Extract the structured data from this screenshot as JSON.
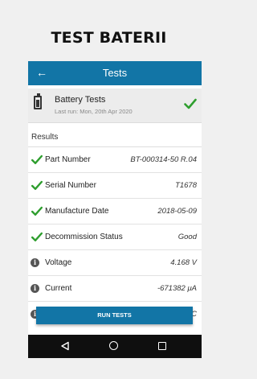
{
  "page": {
    "title": "TEST BATERII"
  },
  "appbar": {
    "back_icon": "arrow-left-icon",
    "title": "Tests"
  },
  "summary": {
    "title": "Battery Tests",
    "subtitle": "Last run: Mon, 20th Apr 2020",
    "status": "passed",
    "icon": "battery-icon"
  },
  "results": {
    "header": "Results",
    "rows": [
      {
        "icon": "check-icon",
        "label": "Part Number",
        "value": "BT-000314-50 R.04"
      },
      {
        "icon": "check-icon",
        "label": "Serial Number",
        "value": "T1678"
      },
      {
        "icon": "check-icon",
        "label": "Manufacture Date",
        "value": "2018-05-09"
      },
      {
        "icon": "check-icon",
        "label": "Decommission Status",
        "value": "Good"
      },
      {
        "icon": "info-icon",
        "label": "Voltage",
        "value": "4.168 V"
      },
      {
        "icon": "info-icon",
        "label": "Current",
        "value": "-671382 μA"
      },
      {
        "icon": "info-icon",
        "label": "",
        "value": "C"
      }
    ]
  },
  "run_button": {
    "label": "RUN TESTS"
  },
  "navbar": {
    "back": "nav-back-icon",
    "home": "nav-home-icon",
    "recent": "nav-recent-icon"
  },
  "colors": {
    "primary": "#1275a6",
    "check": "#2e9e2e",
    "navbar": "#0f0f0f"
  }
}
